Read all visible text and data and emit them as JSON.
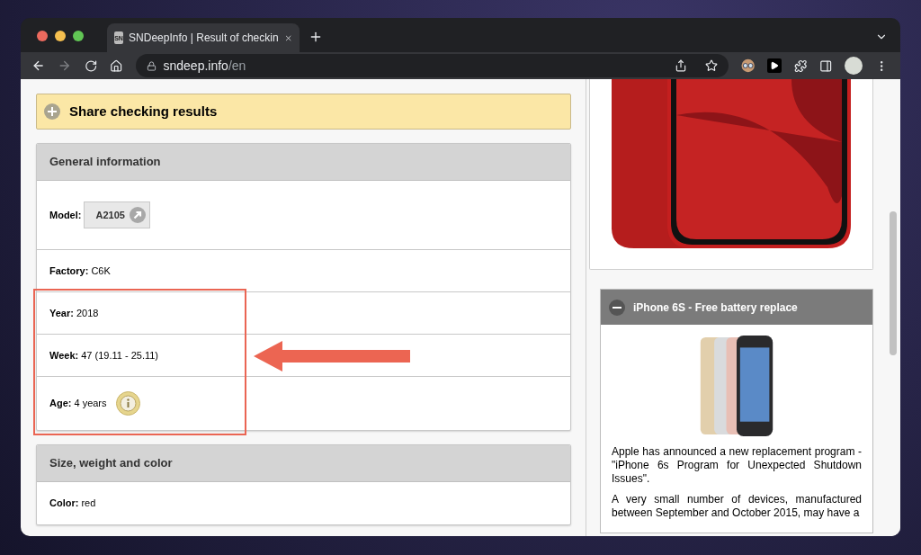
{
  "browser": {
    "tab": {
      "favicon_text": "SN",
      "title": "SNDeepInfo | Result of checkin",
      "selected": true
    },
    "url": {
      "host": "sndeep.info",
      "path": "/en"
    }
  },
  "share": {
    "label": "Share checking results",
    "expanded": false
  },
  "sections": [
    {
      "title": "General information",
      "rows": [
        {
          "label": "Model:",
          "value": "A2105",
          "kind": "link"
        },
        {
          "label": "Factory:",
          "value": "C6K",
          "kind": "text"
        },
        {
          "label": "Year:",
          "value": "2018",
          "kind": "text"
        },
        {
          "label": "Week:",
          "value": "47 (19.11 - 25.11)",
          "kind": "text"
        },
        {
          "label": "Age:",
          "value": "4 years",
          "kind": "info"
        }
      ]
    },
    {
      "title": "Size, weight and color",
      "rows": [
        {
          "label": "Color:",
          "value": "red",
          "kind": "text"
        }
      ]
    }
  ],
  "news": {
    "title": "iPhone 6S - Free battery replace",
    "expanded": true,
    "paragraphs": [
      "Apple has announced a new replacement program - \"iPhone 6s Program for Unexpected Shutdown Issues\".",
      "A very small number of devices, manufactured between September and October 2015, may have a"
    ]
  }
}
